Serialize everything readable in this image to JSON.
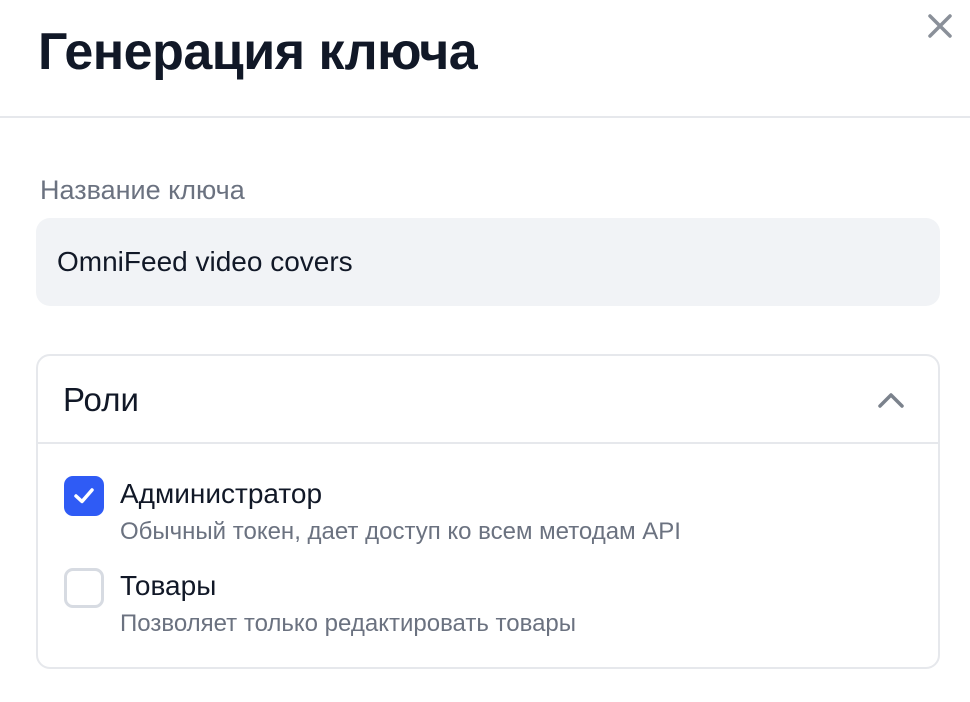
{
  "dialog": {
    "title": "Генерация ключа"
  },
  "key_name": {
    "label": "Название ключа",
    "value": "OmniFeed video covers"
  },
  "roles": {
    "title": "Роли",
    "expanded": true,
    "items": [
      {
        "name": "Администратор",
        "description": "Обычный токен, дает доступ ко всем методам API",
        "checked": true
      },
      {
        "name": "Товары",
        "description": "Позволяет только редактировать товары",
        "checked": false
      }
    ]
  },
  "colors": {
    "accent": "#2f5bf5",
    "text": "#111827",
    "muted": "#6b7280",
    "border": "#e6e8ec",
    "input_bg": "#f1f3f6"
  },
  "icons": {
    "close": "close-icon",
    "collapse": "chevron-up-icon",
    "check": "checkmark-icon"
  }
}
